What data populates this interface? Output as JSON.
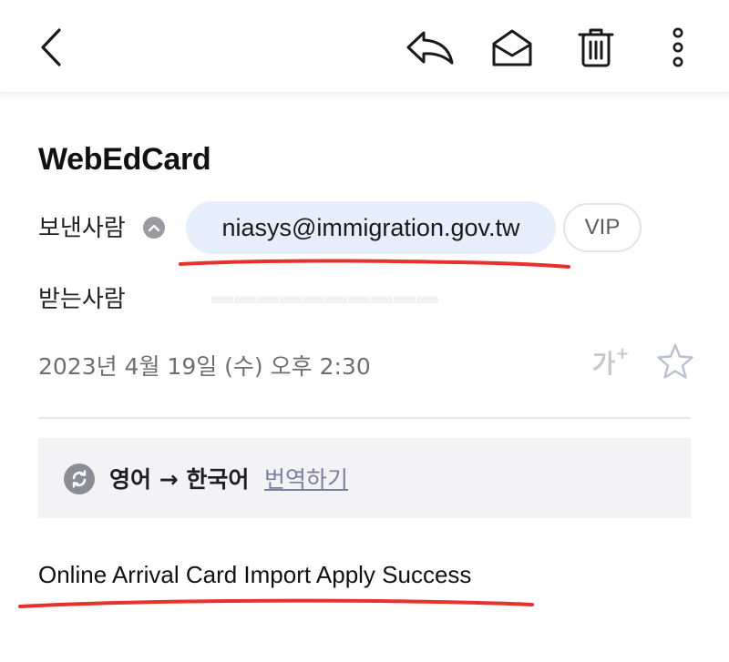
{
  "toolbar": {
    "back_icon": "chevron-left-icon",
    "reply_icon": "reply-icon",
    "mark_unread_icon": "envelope-open-icon",
    "delete_icon": "trash-icon",
    "more_icon": "vertical-dots-icon"
  },
  "header": {
    "sender_name": "WebEdCard",
    "from_label": "보낸사람",
    "from_address": "niasys@immigration.gov.tw",
    "vip_label": "VIP",
    "to_label": "받는사람",
    "date": "2023년 4월 19일 (수) 오후 2:30",
    "text_size_label": "가",
    "text_size_plus": "+"
  },
  "translate": {
    "label": "영어 → 한국어",
    "link": "번역하기"
  },
  "body": {
    "subject": "Online Arrival Card Import Apply Success"
  },
  "colors": {
    "sender_chip_bg": "#e6eefb",
    "annotation_red": "#e8302c",
    "translate_bg": "#f3f3f6"
  }
}
